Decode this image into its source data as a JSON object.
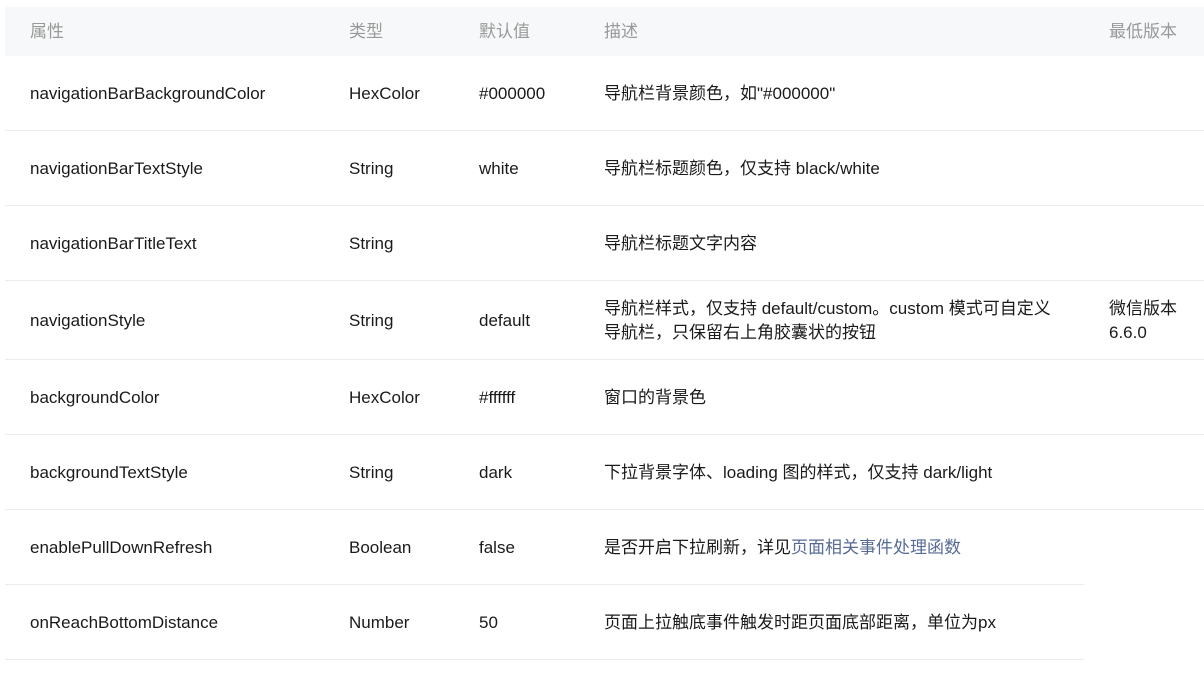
{
  "table": {
    "headers": [
      "属性",
      "类型",
      "默认值",
      "描述",
      "最低版本"
    ],
    "rows": [
      {
        "property": "navigationBarBackgroundColor",
        "type": "HexColor",
        "default": "#000000",
        "description": "导航栏背景颜色，如\"#000000\"",
        "version": ""
      },
      {
        "property": "navigationBarTextStyle",
        "type": "String",
        "default": "white",
        "description": "导航栏标题颜色，仅支持 black/white",
        "version": ""
      },
      {
        "property": "navigationBarTitleText",
        "type": "String",
        "default": "",
        "description": "导航栏标题文字内容",
        "version": ""
      },
      {
        "property": "navigationStyle",
        "type": "String",
        "default": "default",
        "description": "导航栏样式，仅支持 default/custom。custom 模式可自定义导航栏，只保留右上角胶囊状的按钮",
        "version": "微信版本 6.6.0"
      },
      {
        "property": "backgroundColor",
        "type": "HexColor",
        "default": "#ffffff",
        "description": "窗口的背景色",
        "version": ""
      },
      {
        "property": "backgroundTextStyle",
        "type": "String",
        "default": "dark",
        "description": "下拉背景字体、loading 图的样式，仅支持 dark/light",
        "version": ""
      },
      {
        "property": "enablePullDownRefresh",
        "type": "Boolean",
        "default": "false",
        "description": "是否开启下拉刷新，详见",
        "description_link": "页面相关事件处理函数",
        "version": ""
      },
      {
        "property": "onReachBottomDistance",
        "type": "Number",
        "default": "50",
        "description": "页面上拉触底事件触发时距页面底部距离，单位为px",
        "version": ""
      }
    ]
  },
  "colors": {
    "header_bg": "#f7f8f9",
    "header_text": "#999999",
    "body_text": "#1a1a1a",
    "link": "#576b95",
    "row_border": "#ececec"
  }
}
